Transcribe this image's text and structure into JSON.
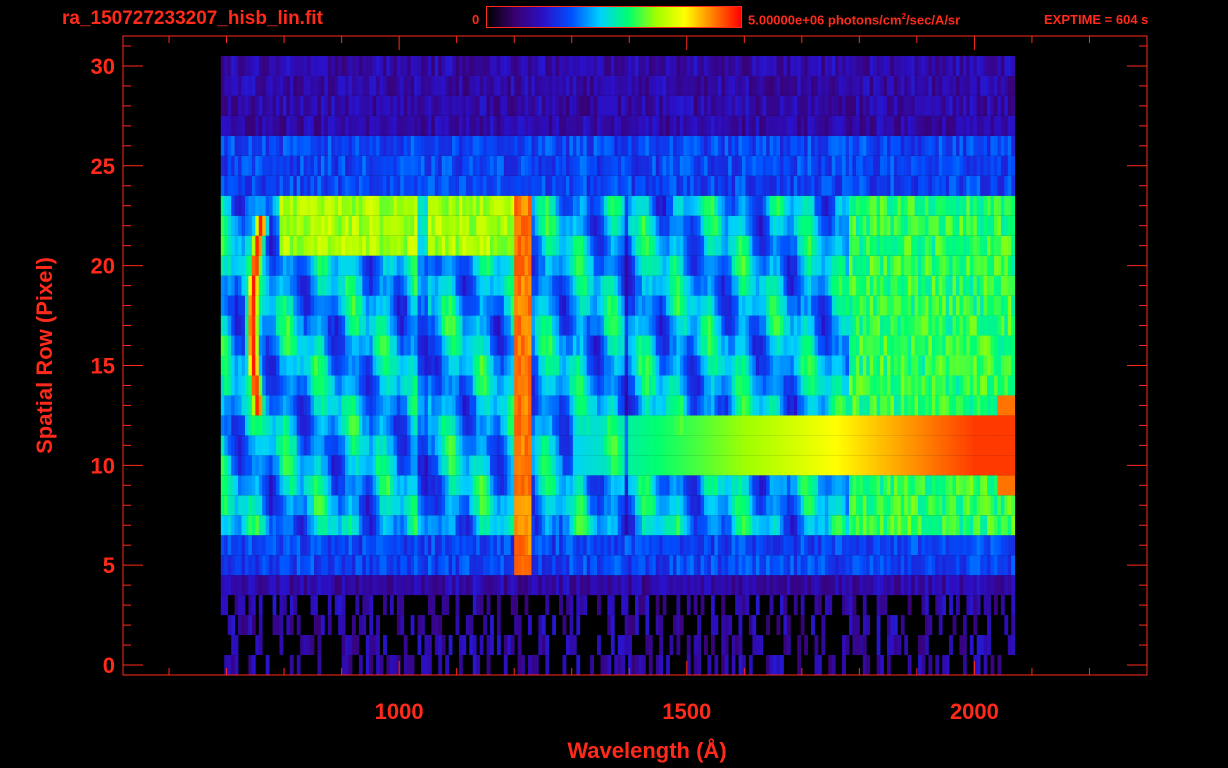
{
  "header": {
    "file_title": "ra_150727233207_hisb_lin.fit",
    "colorbar_min": "0",
    "colorbar_max_prefix": "5.00000e+06 photons/cm",
    "colorbar_max_sup": "2",
    "colorbar_max_suffix": "/sec/A/sr",
    "exptime": "EXPTIME = 604 s"
  },
  "colors": {
    "axis": "#ff2a1a",
    "background": "#000000",
    "colormap": [
      "#000000",
      "#3a0070",
      "#2a10c8",
      "#0050ff",
      "#00d0ff",
      "#00ff70",
      "#a0ff00",
      "#ffff00",
      "#ff8000",
      "#ff0000"
    ]
  },
  "chart_data": {
    "type": "heatmap",
    "title": "ra_150727233207_hisb_lin.fit",
    "xlabel": "Wavelength (Å)",
    "ylabel": "Spatial Row (Pixel)",
    "xlim": [
      520,
      2300
    ],
    "ylim": [
      -0.5,
      31.5
    ],
    "xticks": [
      1000,
      1500,
      2000
    ],
    "yticks": [
      0,
      5,
      10,
      15,
      20,
      25,
      30
    ],
    "color_scale": {
      "min": 0,
      "max": 5000000,
      "units": "photons/cm^2/sec/A/sr",
      "scale": "linear"
    },
    "data_range": {
      "x": [
        690,
        2070
      ],
      "rows": [
        0,
        30
      ]
    },
    "features": [
      {
        "name": "bright curved arc",
        "x": 750,
        "rows": [
          13,
          22
        ],
        "level": 0.95
      },
      {
        "name": "vertical emission line",
        "x": 1215,
        "rows": [
          5,
          23
        ],
        "level": 0.9
      },
      {
        "name": "horizontal bright band",
        "x": [
          1500,
          2060
        ],
        "rows": [
          10,
          12
        ],
        "level": 0.9
      },
      {
        "name": "upper bright band",
        "x": [
          790,
          1220
        ],
        "rows": [
          21,
          23
        ],
        "level": 0.75
      }
    ]
  }
}
